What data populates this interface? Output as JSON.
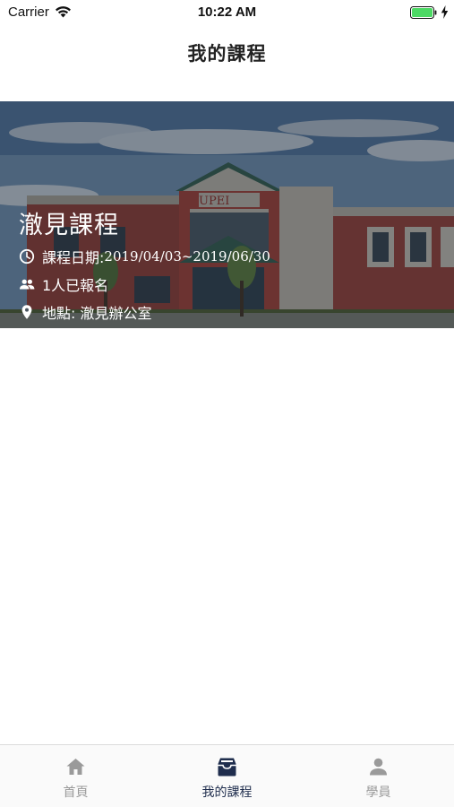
{
  "status_bar": {
    "carrier": "Carrier",
    "time": "10:22 AM",
    "icons": [
      "wifi-icon",
      "battery-icon",
      "charging-bolt-icon"
    ],
    "battery_color": "#4cd964"
  },
  "nav": {
    "title": "我的課程"
  },
  "course": {
    "title": "澈見課程",
    "date_label": "課程日期: ",
    "date_value": "2019/04/03~2019/06/30",
    "enrolled": "1人已報名",
    "location_label": "地點: 澈見辦公室",
    "icons": [
      "clock-icon",
      "people-icon",
      "location-pin-icon"
    ],
    "image_sign": "UPEI"
  },
  "tabs": [
    {
      "label": "首頁",
      "icon": "home-icon",
      "active": false
    },
    {
      "label": "我的課程",
      "icon": "course-box-icon",
      "active": true
    },
    {
      "label": "學員",
      "icon": "person-icon",
      "active": false
    }
  ],
  "colors": {
    "active_tab": "#1f2d4d",
    "inactive_tab": "#9a9a9a",
    "text_on_image": "#ffffff"
  }
}
